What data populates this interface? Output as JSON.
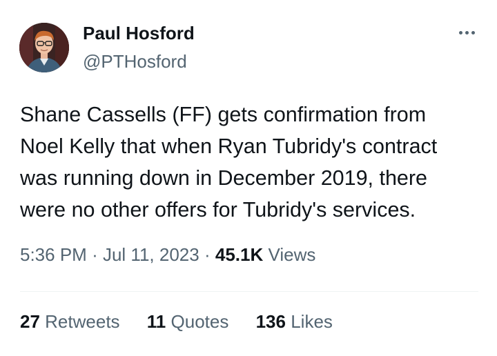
{
  "author": {
    "display_name": "Paul Hosford",
    "handle": "@PTHosford",
    "avatar_icon": "profile-photo"
  },
  "tweet": {
    "text_lines": [
      "Shane Cassells (FF) gets confirmation from",
      "Noel Kelly that when Ryan Tubridy's contract",
      "was running down in December 2019, there",
      "were no other offers for Tubridy's services."
    ],
    "time": "5:36 PM",
    "separator": "·",
    "date": "Jul 11, 2023",
    "views_count": "45.1K",
    "views_label": "Views"
  },
  "stats": {
    "retweets_count": "27",
    "retweets_label": "Retweets",
    "quotes_count": "11",
    "quotes_label": "Quotes",
    "likes_count": "136",
    "likes_label": "Likes"
  },
  "icons": {
    "more": "more-horizontal-icon"
  },
  "colors": {
    "text_primary": "#0f1419",
    "text_secondary": "#536471",
    "divider": "#eff3f4"
  }
}
